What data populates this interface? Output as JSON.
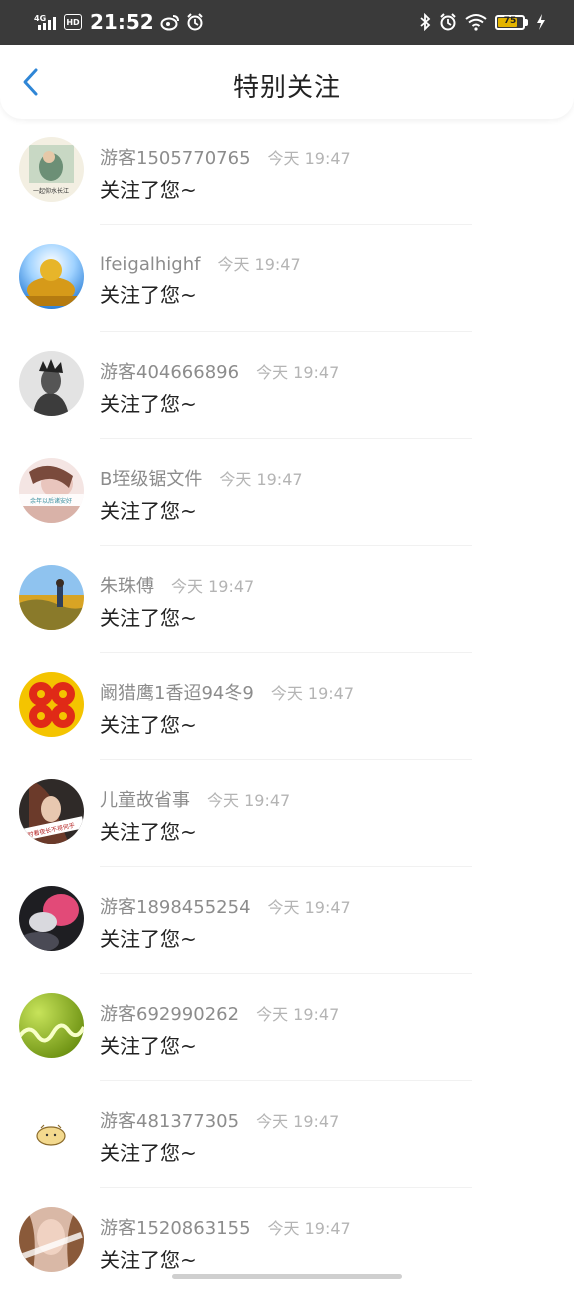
{
  "status_bar": {
    "network": "4G",
    "hd": "HD",
    "time": "21:52",
    "battery": "75",
    "battery_level": 0.75
  },
  "header": {
    "title": "特别关注",
    "back_icon": "chevron-left-icon",
    "accent_color": "#2f86d6"
  },
  "items": [
    {
      "username": "游客1505770765",
      "time": "今天 19:47",
      "message": "关注了您~",
      "avatar_text": "一起仰水长江"
    },
    {
      "username": "lfeigalhighf",
      "time": "今天 19:47",
      "message": "关注了您~"
    },
    {
      "username": "游客404666896",
      "time": "今天 19:47",
      "message": "关注了您~"
    },
    {
      "username": "B垤级锯文件",
      "time": "今天 19:47",
      "message": "关注了您~",
      "avatar_text": "余年以后诸安好"
    },
    {
      "username": "朱珠傅",
      "time": "今天 19:47",
      "message": "关注了您~"
    },
    {
      "username": "阚猎鹰1香迢94冬9",
      "time": "今天 19:47",
      "message": "关注了您~"
    },
    {
      "username": "儿童故省事",
      "time": "今天 19:47",
      "message": "关注了您~",
      "avatar_text": "时看夜长不将何乎"
    },
    {
      "username": "游客1898455254",
      "time": "今天 19:47",
      "message": "关注了您~"
    },
    {
      "username": "游客692990262",
      "time": "今天 19:47",
      "message": "关注了您~"
    },
    {
      "username": "游客481377305",
      "time": "今天 19:47",
      "message": "关注了您~"
    },
    {
      "username": "游客1520863155",
      "time": "今天 19:47",
      "message": "关注了您~"
    }
  ]
}
